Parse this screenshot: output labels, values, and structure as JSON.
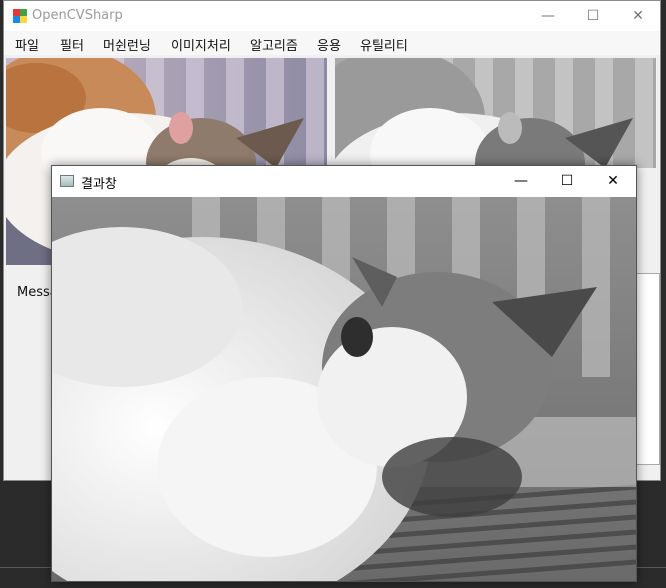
{
  "main_window": {
    "title": "OpenCVSharp",
    "controls": {
      "minimize": "—",
      "maximize": "☐",
      "close": "✕"
    },
    "menu": [
      "파일",
      "필터",
      "머쉰런닝",
      "이미지처리",
      "알고리즘",
      "응용",
      "유틸리티"
    ],
    "message_label": "Messa"
  },
  "result_window": {
    "title": "결과창",
    "controls": {
      "minimize": "—",
      "maximize": "☐",
      "close": "✕"
    }
  },
  "images": {
    "original": "color cat photo",
    "processed": "grayscale cat photo",
    "result": "grayscale cat photo"
  }
}
